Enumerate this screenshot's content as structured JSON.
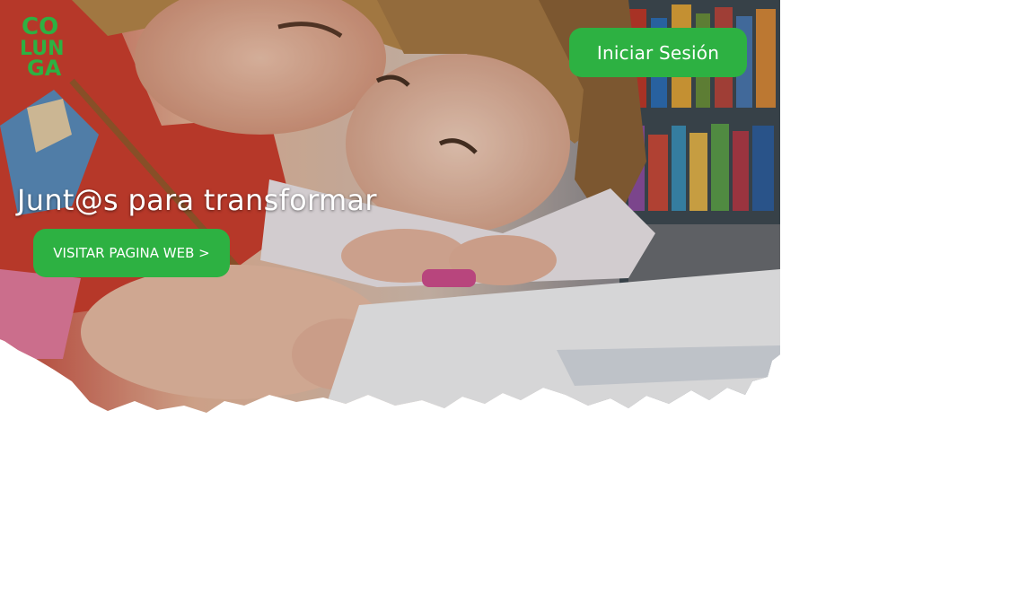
{
  "brand": {
    "logo_lines": [
      "CO",
      "LUN",
      "GA"
    ],
    "logo_color": "#2db142"
  },
  "header": {
    "login_label": "Iniciar Sesión"
  },
  "hero": {
    "tagline": "Junt@s para transformar",
    "cta_label": "VISITAR PAGINA WEB >",
    "image_subject": "children-drawing-photo"
  },
  "colors": {
    "accent": "#2db142",
    "text_on_accent": "#ffffff",
    "page_background": "#ffffff"
  }
}
